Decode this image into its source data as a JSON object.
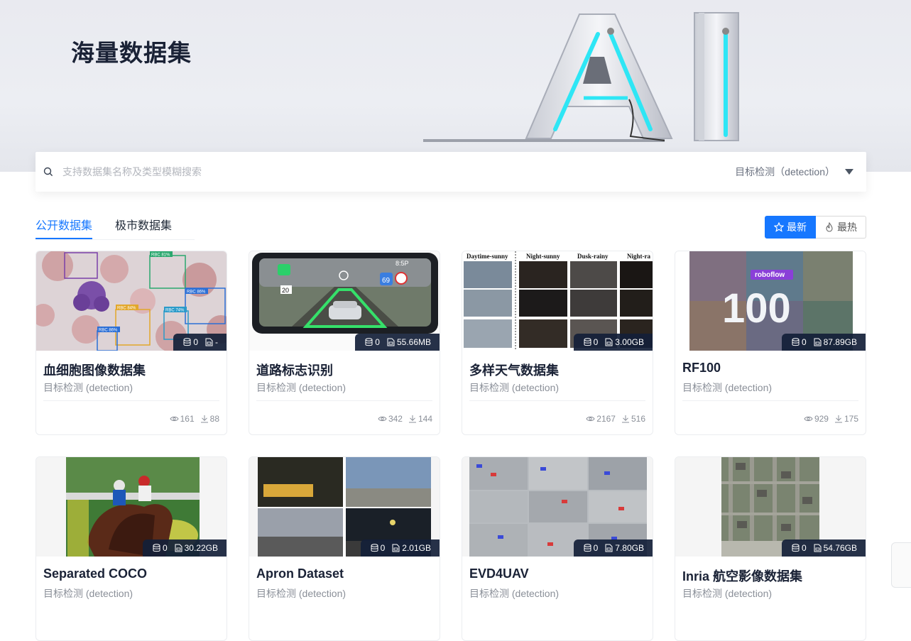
{
  "hero": {
    "title": "海量数据集",
    "art_letters": "AI"
  },
  "search": {
    "placeholder": "支持数据集名称及类型模糊搜索",
    "type_value": "目标检测（detection）"
  },
  "tabs": [
    {
      "label": "公开数据集",
      "active": true
    },
    {
      "label": "极市数据集",
      "active": false
    }
  ],
  "sort": {
    "latest_label": "最新",
    "hot_label": "最热"
  },
  "thumb_text": {
    "weather_headers": [
      "Daytime-sunny",
      "Night-sunny",
      "Dusk-rainy",
      "Night-ra"
    ],
    "rf_brand": "roboflow",
    "rf_number": "100",
    "cell_labels": [
      "RBC 81%",
      "RBC 86%",
      "RBC 84%",
      "RBC 74%",
      "RBC 86%"
    ],
    "dash_speed": "69",
    "dash_sign": "20",
    "dash_time": "8:5P"
  },
  "cards": [
    {
      "title": "血细胞图像数据集",
      "subtitle": "目标检测 (detection)",
      "count": "0",
      "size": "-",
      "views": "161",
      "downloads": "88"
    },
    {
      "title": "道路标志识别",
      "subtitle": "目标检测 (detection)",
      "count": "0",
      "size": "55.66MB",
      "views": "342",
      "downloads": "144"
    },
    {
      "title": "多样天气数据集",
      "subtitle": "目标检测 (detection)",
      "count": "0",
      "size": "3.00GB",
      "views": "2167",
      "downloads": "516"
    },
    {
      "title": "RF100",
      "subtitle": "目标检测 (detection)",
      "count": "0",
      "size": "87.89GB",
      "views": "929",
      "downloads": "175"
    },
    {
      "title": "Separated COCO",
      "subtitle": "目标检测 (detection)",
      "count": "0",
      "size": "30.22GB"
    },
    {
      "title": "Apron Dataset",
      "subtitle": "目标检测 (detection)",
      "count": "0",
      "size": "2.01GB"
    },
    {
      "title": "EVD4UAV",
      "subtitle": "目标检测 (detection)",
      "count": "0",
      "size": "7.80GB"
    },
    {
      "title": "Inria 航空影像数据集",
      "subtitle": "目标检测 (detection)",
      "count": "0",
      "size": "54.76GB"
    }
  ],
  "colors": {
    "accent": "#1677ff",
    "stats_bg": "#142038",
    "title": "#1a2236",
    "muted": "#8a8f98",
    "neon": "#2ee6f5"
  }
}
